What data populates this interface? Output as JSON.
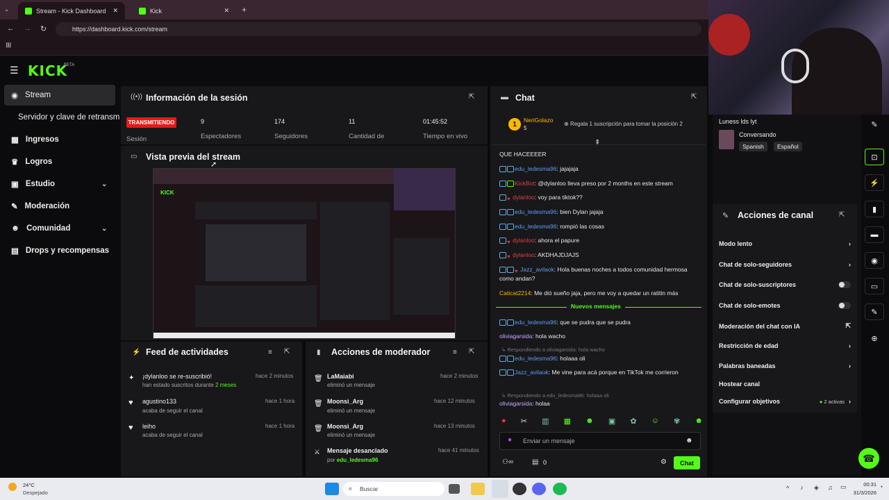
{
  "browser": {
    "tabs": [
      {
        "title": "Stream - Kick Dashboard"
      },
      {
        "title": "Kick"
      }
    ],
    "url": "https://dashboard.kick.com/stream"
  },
  "brand": {
    "logo": "KICK",
    "beta": "BETA",
    "accent": "#53fc18"
  },
  "sidebar": {
    "items": [
      {
        "label": "Stream"
      },
      {
        "label": "Servidor y clave de retransm"
      },
      {
        "label": "Ingresos"
      },
      {
        "label": "Logros"
      },
      {
        "label": "Estudio"
      },
      {
        "label": "Moderación"
      },
      {
        "label": "Comunidad"
      },
      {
        "label": "Drops y recompensas"
      }
    ]
  },
  "session": {
    "title": "Información de la sesión",
    "status": "TRANSMITIENDO",
    "status_label": "Sesión",
    "stats": [
      {
        "value": "9",
        "label": "Espectadores"
      },
      {
        "value": "174",
        "label": "Seguidores"
      },
      {
        "value": "11",
        "label": "Cantidad de"
      },
      {
        "value": "01:45:52",
        "label": "Tiempo en vivo"
      }
    ]
  },
  "preview": {
    "title": "Vista previa del stream"
  },
  "feed": {
    "title": "Feed de actividades",
    "items": [
      {
        "name": "¡dylanloo se re-suscribió!",
        "sub": "han estado suscritos durante",
        "sub2": "2 meses",
        "time": "hace 2 minutos"
      },
      {
        "name": "agustino133",
        "sub": "acaba de seguir el canal",
        "sub2": "",
        "time": "hace 1 hora"
      },
      {
        "name": "leiho",
        "sub": "acaba de seguir el canal",
        "sub2": "",
        "time": "hace 1 hora"
      }
    ]
  },
  "modactions": {
    "title": "Acciones de moderador",
    "items": [
      {
        "name": "LaMaiabi",
        "sub": "eliminó un mensaje",
        "time": "hace 2 minutos"
      },
      {
        "name": "Moonsi_Arg",
        "sub": "eliminó un mensaje",
        "time": "hace 12 minutos"
      },
      {
        "name": "Moonsi_Arg",
        "sub": "eliminó un mensaje",
        "time": "hace 13 minutos"
      },
      {
        "name": "Mensaje desanclado",
        "sub": "por",
        "sub_user": "edu_ledesma96",
        "time": "hace 41 minutos"
      }
    ]
  },
  "chat": {
    "title": "Chat",
    "pinned_user": "NeriGolazo",
    "pinned_count": "5",
    "pinned_text": "Regala 1 suscripción para tomar la posición 2",
    "msgs": [
      {
        "user": "",
        "text": "QUE HACEEEER"
      },
      {
        "user": "edu_ledesma96",
        "text": ": jajajaja"
      },
      {
        "user": "KickBot",
        "text": ": @dylanloo lleva preso por 2 months en este stream"
      },
      {
        "user": "dylanloo",
        "text": ": voy para tiktok??"
      },
      {
        "user": "edu_ledesma96",
        "text": ": bien Dylan jajaja"
      },
      {
        "user": "edu_ledesma96",
        "text": ": rompió las cosas"
      },
      {
        "user": "dylanloo",
        "text": ": ahora el papure"
      },
      {
        "user": "dylanloo",
        "text": ": AKDHAJDJAJS"
      },
      {
        "user": "Jazz_avilaok",
        "text": ": Hola buenas noches a todos comunidad hermosa como andan?"
      },
      {
        "user": "Caticat2214",
        "text": ": Me dió sueño jaja, pero me voy a quedar un ratitin más"
      },
      {
        "user": "edu_ledesma96",
        "text": ": que se pudra que se pudra"
      },
      {
        "user": "oliviagarsida",
        "text": ": hola wacho"
      },
      {
        "user": "edu_ledesma96",
        "text": ": holaaa oli"
      },
      {
        "user": "Jazz_avilaok",
        "text": ": Me vine para acá porque en TikTok me corrieron"
      },
      {
        "user": "oliviagarsida",
        "text": ": holaa"
      }
    ],
    "new_messages": "Nuevos mensajes",
    "reply1": "Respondiendo a oliviagarsida: hola wacho",
    "reply2": "Respondiendo a edu_ledesma96: holaaa oli",
    "input_placeholder": "Enviar un mensaje",
    "send": "Chat",
    "points": "0"
  },
  "webcam": {
    "name": "Luness lds lyt",
    "category": "Conversando",
    "tags": [
      "Spanish",
      "Español"
    ]
  },
  "channel_actions": {
    "title": "Acciones de canal",
    "items": [
      {
        "label": "Modo lento"
      },
      {
        "label": "Chat de solo-seguidores"
      },
      {
        "label": "Chat de solo-suscriptores"
      },
      {
        "label": "Chat de solo-emotes"
      },
      {
        "label": "Moderación del chat con IA"
      },
      {
        "label": "Restricción de edad"
      },
      {
        "label": "Palabras baneadas"
      },
      {
        "label": "Hostear canal"
      },
      {
        "label": "Configurar objetivos"
      }
    ],
    "goals_active": "2 activas"
  },
  "taskbar": {
    "temp": "24°C",
    "weather": "Despejado",
    "search": "Buscar",
    "time": "00:31",
    "date": "31/3/2026"
  }
}
